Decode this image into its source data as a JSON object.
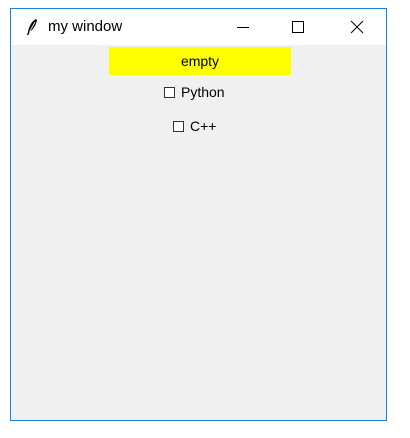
{
  "window": {
    "title": "my window"
  },
  "label": {
    "text": "empty",
    "background": "#ffff00"
  },
  "checkboxes": [
    {
      "label": "Python",
      "checked": false
    },
    {
      "label": "C++",
      "checked": false
    }
  ],
  "colors": {
    "border": "#1883d7",
    "client_bg": "#f0f0f0"
  },
  "icons": {
    "app": "feather-icon",
    "minimize": "minimize-icon",
    "maximize": "maximize-icon",
    "close": "close-icon"
  }
}
